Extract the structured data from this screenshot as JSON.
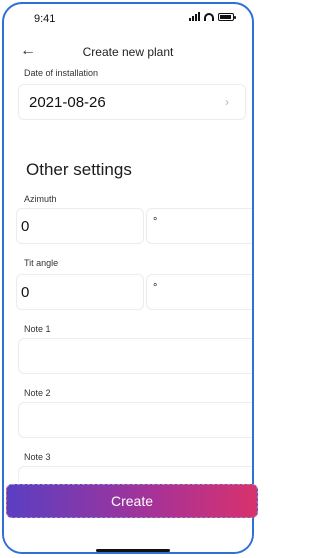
{
  "status_bar": {
    "time": "9:41"
  },
  "header": {
    "back_icon": "arrow-left-icon",
    "title": "Create new plant"
  },
  "date_of_installation": {
    "label": "Date of installation",
    "value": "2021-08-26",
    "chevron_icon": "chevron-right-icon"
  },
  "other_settings": {
    "title": "Other settings",
    "azimuth": {
      "label": "Azimuth",
      "value": "0",
      "unit": "°"
    },
    "tilt_angle": {
      "label": "Tit angle",
      "value": "0",
      "unit": "°"
    },
    "notes": [
      {
        "label": "Note 1",
        "value": ""
      },
      {
        "label": "Note 2",
        "value": ""
      },
      {
        "label": "Note 3",
        "value": ""
      }
    ]
  },
  "actions": {
    "create_label": "Create"
  },
  "colors": {
    "frame": "#2f6fd8",
    "gradient_start": "#5a3fc2",
    "gradient_end": "#d8326c"
  }
}
